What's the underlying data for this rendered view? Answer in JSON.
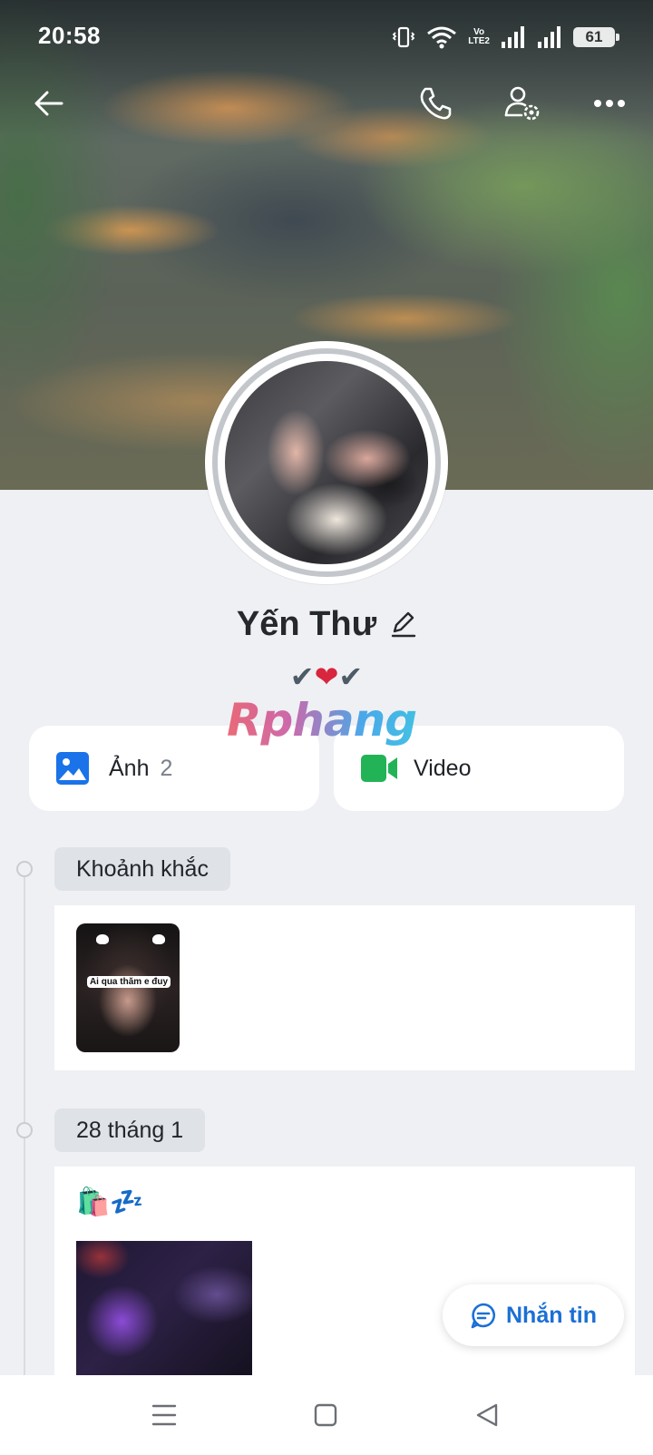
{
  "status_bar": {
    "time": "20:58",
    "lte_top": "Vo",
    "lte_bottom": "LTE2",
    "battery": "61"
  },
  "top_nav": {
    "icons": [
      "back-arrow-icon",
      "phone-icon",
      "user-settings-icon",
      "more-icon"
    ]
  },
  "profile": {
    "name": "Yến Thư",
    "bio_parts": [
      "✔",
      "❤",
      "✔"
    ]
  },
  "watermark": "Rphang",
  "media": {
    "photos_label": "Ảnh",
    "photos_count": "2",
    "video_label": "Video",
    "colors": {
      "photo_icon": "#1a73e8",
      "video_icon": "#22b357"
    }
  },
  "timeline": {
    "moments_title": "Khoảnh khắc",
    "moment_caption": "Ai qua thăm e đuy",
    "date_title": "28 tháng 1",
    "post_text": "🛍️💤"
  },
  "actions": {
    "message_label": "Nhắn tin",
    "accent": "#1b6fd6"
  },
  "system_nav": [
    "menu-icon",
    "home-icon",
    "back-triangle-icon"
  ]
}
